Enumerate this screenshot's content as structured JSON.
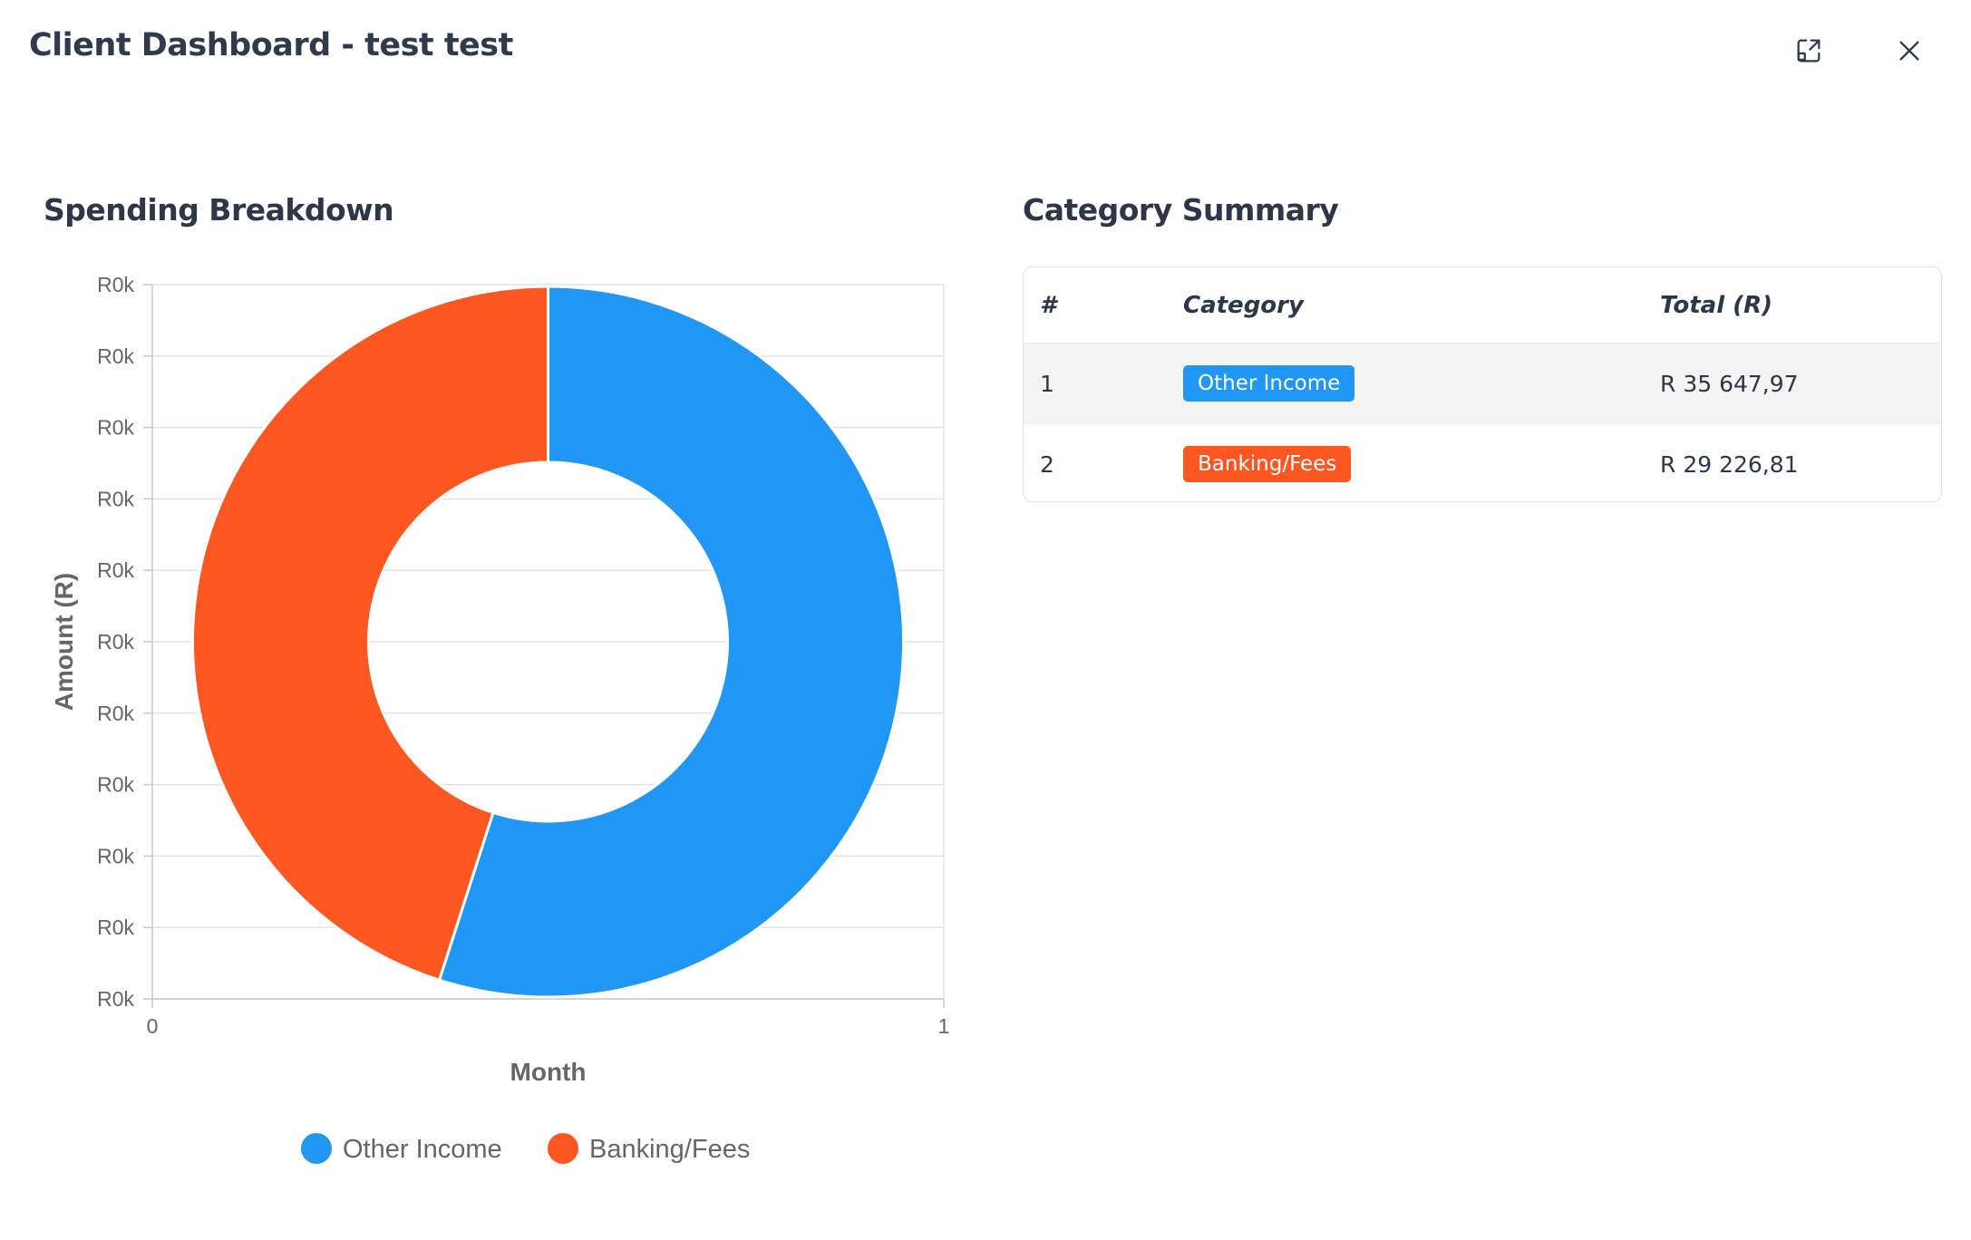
{
  "header": {
    "title": "Client Dashboard - test test",
    "expand_icon": "expand-icon",
    "close_icon": "close-icon"
  },
  "spending": {
    "title": "Spending Breakdown"
  },
  "category_summary": {
    "title": "Category Summary",
    "columns": [
      "#",
      "Category",
      "Total (R)"
    ],
    "rows": [
      {
        "index": "1",
        "category": "Other Income",
        "total": "R 35 647,97",
        "color": "#2196f3"
      },
      {
        "index": "2",
        "category": "Banking/Fees",
        "total": "R 29 226,81",
        "color": "#ff5722"
      }
    ]
  },
  "chart_data": {
    "type": "pie",
    "title": "",
    "xlabel": "Month",
    "ylabel": "Amount (R)",
    "y_tick_labels": [
      "R0k",
      "R0k",
      "R0k",
      "R0k",
      "R0k",
      "R0k",
      "R0k",
      "R0k",
      "R0k",
      "R0k",
      "R0k"
    ],
    "x_tick_labels": [
      "0",
      "1"
    ],
    "grid": true,
    "legend_position": "bottom",
    "series": [
      {
        "name": "Other Income",
        "value": 35647.97,
        "color": "#2196f3"
      },
      {
        "name": "Banking/Fees",
        "value": 29226.81,
        "color": "#ff5722"
      }
    ]
  }
}
